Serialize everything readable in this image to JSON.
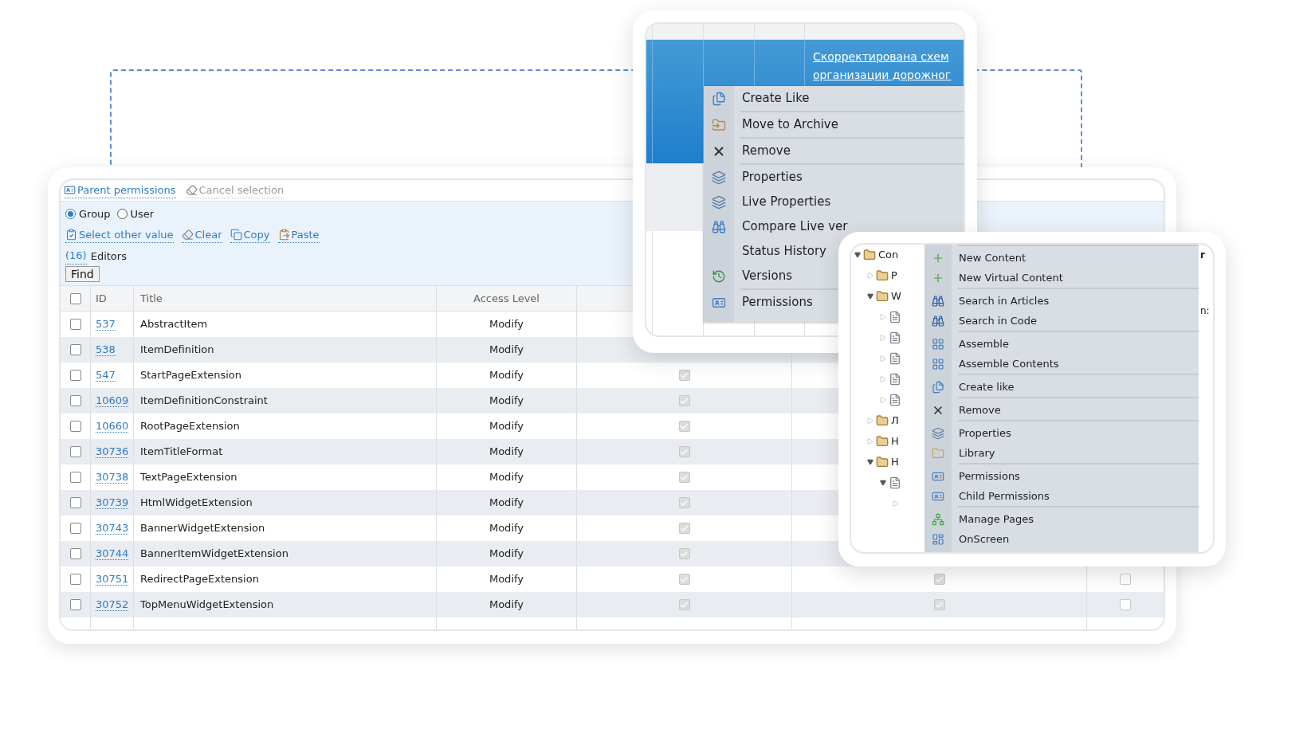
{
  "permissions_panel": {
    "toolbar": [
      {
        "label": "Parent permissions",
        "kind": "permissions",
        "disabled": false
      },
      {
        "label": "Cancel selection",
        "kind": "eraser",
        "disabled": true
      }
    ],
    "principal_type": [
      {
        "label": "Group",
        "selected": true
      },
      {
        "label": "User",
        "selected": false
      }
    ],
    "actions": [
      {
        "label": "Select other value",
        "kind": "select"
      },
      {
        "label": "Clear",
        "kind": "eraser"
      },
      {
        "label": "Copy",
        "kind": "copy"
      },
      {
        "label": "Paste",
        "kind": "paste"
      }
    ],
    "selection": {
      "count": "(16)",
      "name": "Editors"
    },
    "find_button": "Find",
    "table": {
      "header_checked": false,
      "columns": [
        "ID",
        "Title",
        "Access Level"
      ],
      "rows": [
        {
          "id": "537",
          "title": "AbstractItem",
          "access": "Modify",
          "selected": false
        },
        {
          "id": "538",
          "title": "ItemDefinition",
          "access": "Modify",
          "selected": false
        },
        {
          "id": "547",
          "title": "StartPageExtension",
          "access": "Modify",
          "selected": false,
          "column_5": {
            "checked": true
          }
        },
        {
          "id": "10609",
          "title": "ItemDefinitionConstraint",
          "access": "Modify",
          "selected": false,
          "column_5": {
            "checked": true
          }
        },
        {
          "id": "10660",
          "title": "RootPageExtension",
          "access": "Modify",
          "selected": false,
          "column_5": {
            "checked": true
          }
        },
        {
          "id": "30736",
          "title": "ItemTitleFormat",
          "access": "Modify",
          "selected": false,
          "column_5": {
            "checked": true
          }
        },
        {
          "id": "30738",
          "title": "TextPageExtension",
          "access": "Modify",
          "selected": false,
          "column_5": {
            "checked": true
          }
        },
        {
          "id": "30739",
          "title": "HtmlWidgetExtension",
          "access": "Modify",
          "selected": false,
          "column_5": {
            "checked": true
          }
        },
        {
          "id": "30743",
          "title": "BannerWidgetExtension",
          "access": "Modify",
          "selected": false,
          "column_5": {
            "checked": true
          }
        },
        {
          "id": "30744",
          "title": "BannerItemWidgetExtension",
          "access": "Modify",
          "selected": false,
          "column_5": {
            "checked": true
          }
        },
        {
          "id": "30751",
          "title": "RedirectPageExtension",
          "access": "Modify",
          "selected": false,
          "column_5": {
            "checked": true
          },
          "column_6": {
            "checked": true
          },
          "column_7": {
            "checked": false
          }
        },
        {
          "id": "30752",
          "title": "TopMenuWidgetExtension",
          "access": "Modify",
          "selected": false,
          "column_5": {
            "checked": true
          },
          "column_6": {
            "checked": true
          },
          "column_7": {
            "checked": false
          }
        }
      ]
    }
  },
  "context_menu_window": {
    "selected_row": {
      "link_lines": [
        "Скорректирована схем",
        "организации дорожног"
      ]
    },
    "menu": {
      "groups": [
        [
          {
            "label": "Create Like",
            "kind": "create"
          }
        ],
        [
          {
            "label": "Move to Archive",
            "kind": "archive"
          }
        ],
        [
          {
            "label": "Remove",
            "kind": "remove"
          }
        ],
        [
          {
            "label": "Properties",
            "kind": "properties"
          },
          {
            "label": "Live Properties",
            "kind": "properties"
          },
          {
            "label": "Compare Live ver",
            "kind": "compare"
          },
          {
            "label": "Status History",
            "kind": "plain"
          },
          {
            "label": "Versions",
            "kind": "versions"
          }
        ],
        [
          {
            "label": "Permissions",
            "kind": "permissions"
          }
        ]
      ]
    }
  },
  "tree_menu_window": {
    "tree": [
      {
        "label": "Con",
        "kind": "folder",
        "expanded": true,
        "children": [
          {
            "label": "P",
            "kind": "folder",
            "expanded": false
          },
          {
            "label": "W",
            "kind": "folder",
            "expanded": true,
            "children": [
              {
                "kind": "document",
                "expanded": false
              },
              {
                "kind": "document",
                "expanded": false
              },
              {
                "kind": "document",
                "expanded": false
              },
              {
                "kind": "document",
                "expanded": false
              },
              {
                "kind": "document",
                "expanded": false
              }
            ]
          },
          {
            "label": "Л",
            "kind": "folder",
            "expanded": false
          },
          {
            "label": "H",
            "kind": "folder",
            "expanded": false
          },
          {
            "label": "H",
            "kind": "folder",
            "expanded": true,
            "children": [
              {
                "kind": "document",
                "expanded": true,
                "children": [
                  {
                    "expanded": false
                  }
                ]
              }
            ]
          }
        ]
      }
    ],
    "menu": {
      "groups": [
        [
          {
            "label": "New Content",
            "kind": "plus"
          },
          {
            "label": "New Virtual Content",
            "kind": "plus"
          }
        ],
        [
          {
            "label": "Search in Articles",
            "kind": "search"
          },
          {
            "label": "Search in Code",
            "kind": "search"
          }
        ],
        [
          {
            "label": "Assemble",
            "kind": "assemble"
          },
          {
            "label": "Assemble Contents",
            "kind": "assemble"
          }
        ],
        [
          {
            "label": "Create like",
            "kind": "create"
          }
        ],
        [
          {
            "label": "Remove",
            "kind": "remove"
          }
        ],
        [
          {
            "label": "Properties",
            "kind": "properties"
          },
          {
            "label": "Library",
            "kind": "library"
          }
        ],
        [
          {
            "label": "Permissions",
            "kind": "permissions"
          },
          {
            "label": "Child Permissions",
            "kind": "permissions"
          }
        ],
        [
          {
            "label": "Manage Pages",
            "kind": "pages"
          },
          {
            "label": "OnScreen",
            "kind": "onscreen"
          }
        ]
      ]
    },
    "side_fragments": [
      "r",
      "n:"
    ]
  }
}
